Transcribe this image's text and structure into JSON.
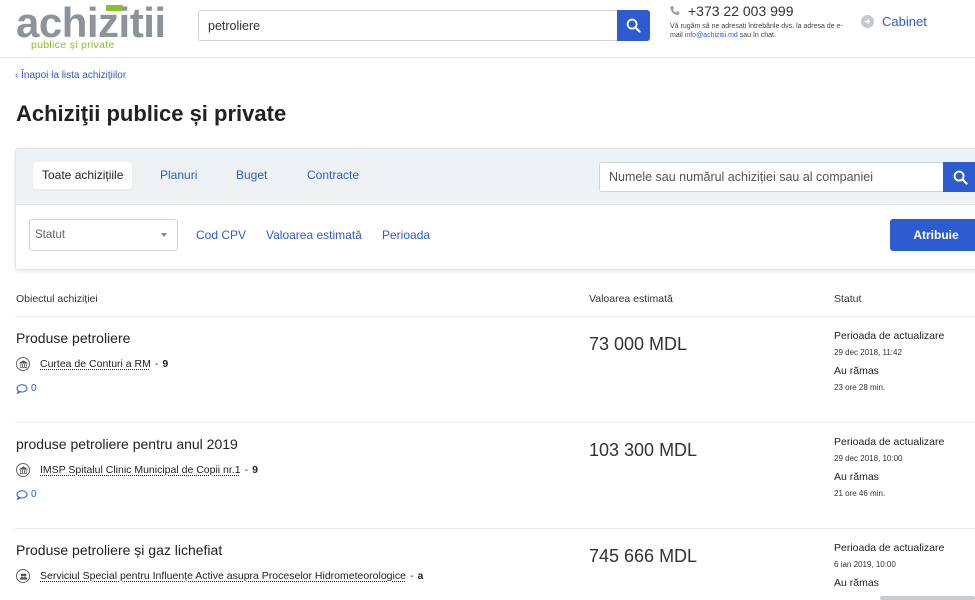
{
  "header": {
    "logo_word": "achizitii",
    "logo_sub": "publice și private",
    "search_value": "petroliere",
    "phone": "+373 22 003 999",
    "note_before": "Vă rugăm să ne adresați întrebările dvs. la adresa de e-mail ",
    "note_email": "info@achizitii.md",
    "note_after": " sau în chat.",
    "cabinet_label": "Cabinet"
  },
  "back_link": "‹ Înapoi la lista achizițiilor",
  "page_title": "Achiziţii publice și private",
  "tabs": [
    {
      "label": "Toate achizițiile",
      "active": true
    },
    {
      "label": "Planuri",
      "active": false
    },
    {
      "label": "Buget",
      "active": false
    },
    {
      "label": "Contracte",
      "active": false
    }
  ],
  "panel_search_placeholder": "Numele sau numărul achiziției sau al companiei",
  "filters": {
    "status_select": "Statut",
    "cpv": "Cod CPV",
    "estimated_value": "Valoarea estimată",
    "period": "Perioada",
    "apply": "Atribuie"
  },
  "table_headers": {
    "object": "Obiectul achiziției",
    "value": "Valoarea estimată",
    "status": "Statut"
  },
  "rows": [
    {
      "title": "Produse petroliere",
      "org_icon": "institution-icon",
      "org": "Curtea de Conturi a RM",
      "org_count": "9",
      "comments": "0",
      "value": "73 000 MDL",
      "status_label": "Perioada de actualizare",
      "status_date": "29 dec 2018, 11:42",
      "remaining_label": "Au rămas",
      "remaining_time": "23 ore 28 min."
    },
    {
      "title": "produse petroliere pentru anul 2019",
      "org_icon": "institution-icon",
      "org": "IMSP Spitalul Clinic Municipal de Copii nr.1",
      "org_count": "9",
      "comments": "0",
      "value": "103 300 MDL",
      "status_label": "Perioada de actualizare",
      "status_date": "29 dec 2018, 10:00",
      "remaining_label": "Au rămas",
      "remaining_time": "21 ore 46 min."
    },
    {
      "title": "Produse petroliere și gaz lichefiat",
      "org_icon": "users-icon",
      "org": "Serviciul Special pentru Influențe Active asupra Proceselor Hidrometeorologice",
      "org_count": "a",
      "comments": "",
      "value": "745 666 MDL",
      "status_label": "Perioada de actualizare",
      "status_date": "6 ian 2019, 10:00",
      "remaining_label": "Au rămas",
      "remaining_time": ""
    }
  ],
  "colors": {
    "accent": "#2d5bd0",
    "logo_grey": "#8c9399",
    "logo_green": "#8bbf2e"
  }
}
